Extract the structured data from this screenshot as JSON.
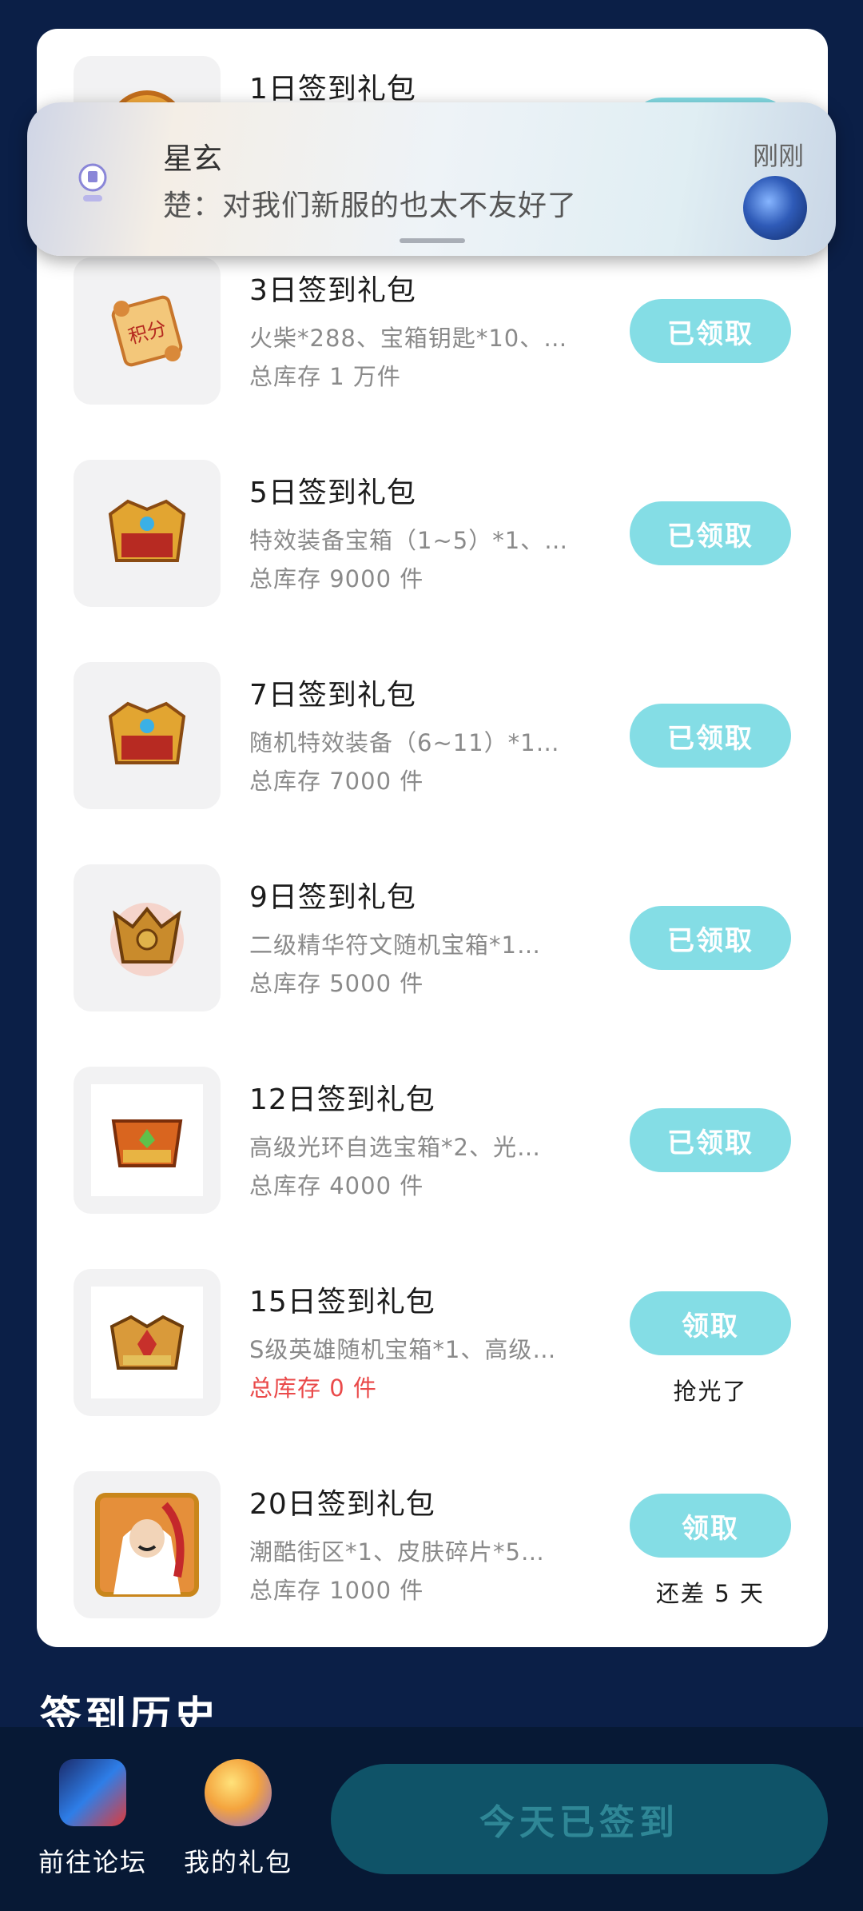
{
  "gifts": [
    {
      "title": "1日签到礼包",
      "desc": "",
      "stock": "",
      "button": "",
      "note": ""
    },
    {
      "title": "3日签到礼包",
      "desc": "火柴*288、宝箱钥匙*10、…",
      "stock": "总库存 1 万件",
      "button": "已领取",
      "note": ""
    },
    {
      "title": "5日签到礼包",
      "desc": "特效装备宝箱（1~5）*1、…",
      "stock": "总库存 9000 件",
      "button": "已领取",
      "note": ""
    },
    {
      "title": "7日签到礼包",
      "desc": "随机特效装备（6~11）*1…",
      "stock": "总库存 7000 件",
      "button": "已领取",
      "note": ""
    },
    {
      "title": "9日签到礼包",
      "desc": "二级精华符文随机宝箱*1…",
      "stock": "总库存 5000 件",
      "button": "已领取",
      "note": ""
    },
    {
      "title": "12日签到礼包",
      "desc": "高级光环自选宝箱*2、光…",
      "stock": "总库存 4000 件",
      "button": "已领取",
      "note": ""
    },
    {
      "title": "15日签到礼包",
      "desc": "S级英雄随机宝箱*1、高级…",
      "stock": "总库存 0 件",
      "button": "领取",
      "note": "抢光了"
    },
    {
      "title": "20日签到礼包",
      "desc": "潮酷街区*1、皮肤碎片*5…",
      "stock": "总库存 1000 件",
      "button": "领取",
      "note": "还差 5 天"
    }
  ],
  "notification": {
    "sender": "星玄",
    "message": "楚：对我们新服的也太不友好了",
    "time": "刚刚",
    "app_icon": "app-icon",
    "avatar": "avatar-image"
  },
  "section_title": "签到历史",
  "bottom": {
    "forum_label": "前往论坛",
    "gifts_label": "我的礼包",
    "checkin_button": "今天已签到"
  },
  "colors": {
    "background": "#0b1f47",
    "claimed_button": "#84dde5",
    "stock_zero": "#ea4a4a",
    "checked_in_button": "#0f5368"
  }
}
